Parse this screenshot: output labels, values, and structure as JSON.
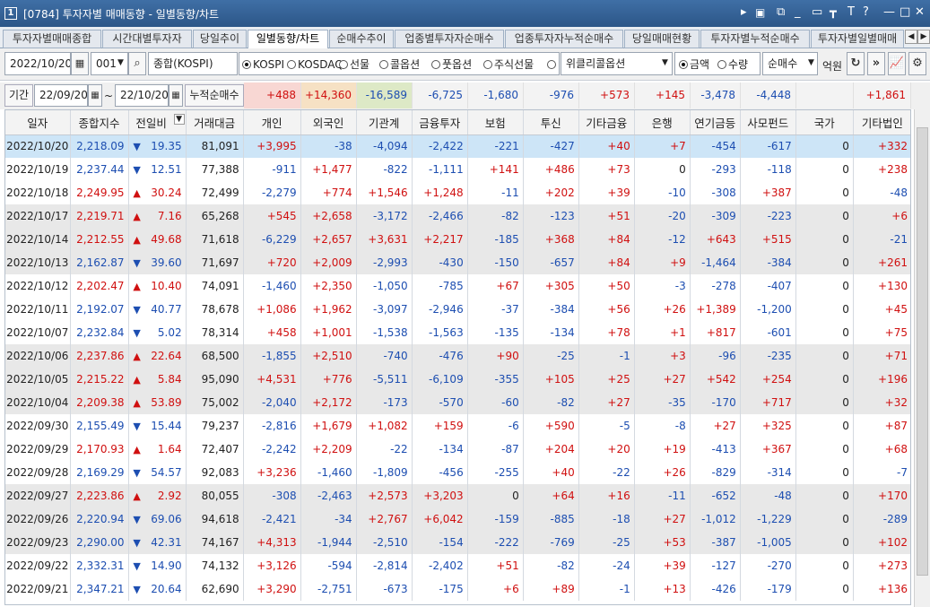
{
  "window": {
    "badge": "1",
    "title": "[0784] 투자자별 매매동향 - 일별동향/차트",
    "controls": [
      "▸",
      "▣",
      "⧉",
      "_",
      "▭",
      "┳",
      "T",
      "?",
      "—",
      "□",
      "✕"
    ]
  },
  "tabs": [
    "투자자별매매종합",
    "시간대별투자자",
    "당일추이",
    "일별동향/차트",
    "순매수추이",
    "업종별투자자순매수",
    "업종투자자누적순매수",
    "당일매매현황",
    "투자자별누적순매수",
    "투자자별일별매매"
  ],
  "active_tab": 3,
  "toolbar": {
    "date": "2022/10/20",
    "code": "001",
    "market": "종합(KOSPI)",
    "markets": [
      "KOSPI",
      "KOSDAQ",
      "선물",
      "콜옵션",
      "풋옵션",
      "주식선물",
      ""
    ],
    "market_selected": 0,
    "weekly": "위클리콜옵션",
    "unit_options": [
      "금액",
      "수량"
    ],
    "unit_selected": 0,
    "type": "순매수",
    "unit_label": "억원"
  },
  "period": {
    "label": "기간",
    "from": "22/09/20",
    "to": "22/10/20",
    "sum_label": "누적순매수",
    "sums": [
      "+488",
      "+14,360",
      "-16,589",
      "-6,725",
      "-1,680",
      "-976",
      "+573",
      "+145",
      "-3,478",
      "-4,448",
      "",
      "+1,861"
    ]
  },
  "columns": [
    "일자",
    "종합지수",
    "전일비",
    "거래대금",
    "개인",
    "외국인",
    "기관계",
    "금융투자",
    "보험",
    "투신",
    "기타금융",
    "은행",
    "연기금등",
    "사모펀드",
    "국가",
    "기타법인"
  ],
  "rows": [
    [
      "2022/10/20",
      "2,218.09",
      "down",
      "19.35",
      "81,091",
      "+3,995",
      "-38",
      "-4,094",
      "-2,422",
      "-221",
      "-427",
      "+40",
      "+7",
      "-454",
      "-617",
      "0",
      "+332"
    ],
    [
      "2022/10/19",
      "2,237.44",
      "down",
      "12.51",
      "77,388",
      "-911",
      "+1,477",
      "-822",
      "-1,111",
      "+141",
      "+486",
      "+73",
      "0",
      "-293",
      "-118",
      "0",
      "+238"
    ],
    [
      "2022/10/18",
      "2,249.95",
      "up",
      "30.24",
      "72,499",
      "-2,279",
      "+774",
      "+1,546",
      "+1,248",
      "-11",
      "+202",
      "+39",
      "-10",
      "-308",
      "+387",
      "0",
      "-48"
    ],
    [
      "2022/10/17",
      "2,219.71",
      "up",
      "7.16",
      "65,268",
      "+545",
      "+2,658",
      "-3,172",
      "-2,466",
      "-82",
      "-123",
      "+51",
      "-20",
      "-309",
      "-223",
      "0",
      "+6"
    ],
    [
      "2022/10/14",
      "2,212.55",
      "up",
      "49.68",
      "71,618",
      "-6,229",
      "+2,657",
      "+3,631",
      "+2,217",
      "-185",
      "+368",
      "+84",
      "-12",
      "+643",
      "+515",
      "0",
      "-21"
    ],
    [
      "2022/10/13",
      "2,162.87",
      "down",
      "39.60",
      "71,697",
      "+720",
      "+2,009",
      "-2,993",
      "-430",
      "-150",
      "-657",
      "+84",
      "+9",
      "-1,464",
      "-384",
      "0",
      "+261"
    ],
    [
      "2022/10/12",
      "2,202.47",
      "up",
      "10.40",
      "74,091",
      "-1,460",
      "+2,350",
      "-1,050",
      "-785",
      "+67",
      "+305",
      "+50",
      "-3",
      "-278",
      "-407",
      "0",
      "+130"
    ],
    [
      "2022/10/11",
      "2,192.07",
      "down",
      "40.77",
      "78,678",
      "+1,086",
      "+1,962",
      "-3,097",
      "-2,946",
      "-37",
      "-384",
      "+56",
      "+26",
      "+1,389",
      "-1,200",
      "0",
      "+45"
    ],
    [
      "2022/10/07",
      "2,232.84",
      "down",
      "5.02",
      "78,314",
      "+458",
      "+1,001",
      "-1,538",
      "-1,563",
      "-135",
      "-134",
      "+78",
      "+1",
      "+817",
      "-601",
      "0",
      "+75"
    ],
    [
      "2022/10/06",
      "2,237.86",
      "up",
      "22.64",
      "68,500",
      "-1,855",
      "+2,510",
      "-740",
      "-476",
      "+90",
      "-25",
      "-1",
      "+3",
      "-96",
      "-235",
      "0",
      "+71"
    ],
    [
      "2022/10/05",
      "2,215.22",
      "up",
      "5.84",
      "95,090",
      "+4,531",
      "+776",
      "-5,511",
      "-6,109",
      "-355",
      "+105",
      "+25",
      "+27",
      "+542",
      "+254",
      "0",
      "+196"
    ],
    [
      "2022/10/04",
      "2,209.38",
      "up",
      "53.89",
      "75,002",
      "-2,040",
      "+2,172",
      "-173",
      "-570",
      "-60",
      "-82",
      "+27",
      "-35",
      "-170",
      "+717",
      "0",
      "+32"
    ],
    [
      "2022/09/30",
      "2,155.49",
      "down",
      "15.44",
      "79,237",
      "-2,816",
      "+1,679",
      "+1,082",
      "+159",
      "-6",
      "+590",
      "-5",
      "-8",
      "+27",
      "+325",
      "0",
      "+87"
    ],
    [
      "2022/09/29",
      "2,170.93",
      "up",
      "1.64",
      "72,407",
      "-2,242",
      "+2,209",
      "-22",
      "-134",
      "-87",
      "+204",
      "+20",
      "+19",
      "-413",
      "+367",
      "0",
      "+68"
    ],
    [
      "2022/09/28",
      "2,169.29",
      "down",
      "54.57",
      "92,083",
      "+3,236",
      "-1,460",
      "-1,809",
      "-456",
      "-255",
      "+40",
      "-22",
      "+26",
      "-829",
      "-314",
      "0",
      "-7"
    ],
    [
      "2022/09/27",
      "2,223.86",
      "up",
      "2.92",
      "80,055",
      "-308",
      "-2,463",
      "+2,573",
      "+3,203",
      "0",
      "+64",
      "+16",
      "-11",
      "-652",
      "-48",
      "0",
      "+170"
    ],
    [
      "2022/09/26",
      "2,220.94",
      "down",
      "69.06",
      "94,618",
      "-2,421",
      "-34",
      "+2,767",
      "+6,042",
      "-159",
      "-885",
      "-18",
      "+27",
      "-1,012",
      "-1,229",
      "0",
      "-289"
    ],
    [
      "2022/09/23",
      "2,290.00",
      "down",
      "42.31",
      "74,167",
      "+4,313",
      "-1,944",
      "-2,510",
      "-154",
      "-222",
      "-769",
      "-25",
      "+53",
      "-387",
      "-1,005",
      "0",
      "+102"
    ],
    [
      "2022/09/22",
      "2,332.31",
      "down",
      "14.90",
      "74,132",
      "+3,126",
      "-594",
      "-2,814",
      "-2,402",
      "+51",
      "-82",
      "-24",
      "+39",
      "-127",
      "-270",
      "0",
      "+273"
    ],
    [
      "2022/09/21",
      "2,347.21",
      "down",
      "20.64",
      "62,690",
      "+3,290",
      "-2,751",
      "-673",
      "-175",
      "+6",
      "+89",
      "-1",
      "+13",
      "-426",
      "-179",
      "0",
      "+136"
    ]
  ],
  "colors": {
    "up": "#d01010",
    "down": "#1d4eb1",
    "selected_row": "#cde5f7",
    "alt_row": "#e8e8e8"
  }
}
